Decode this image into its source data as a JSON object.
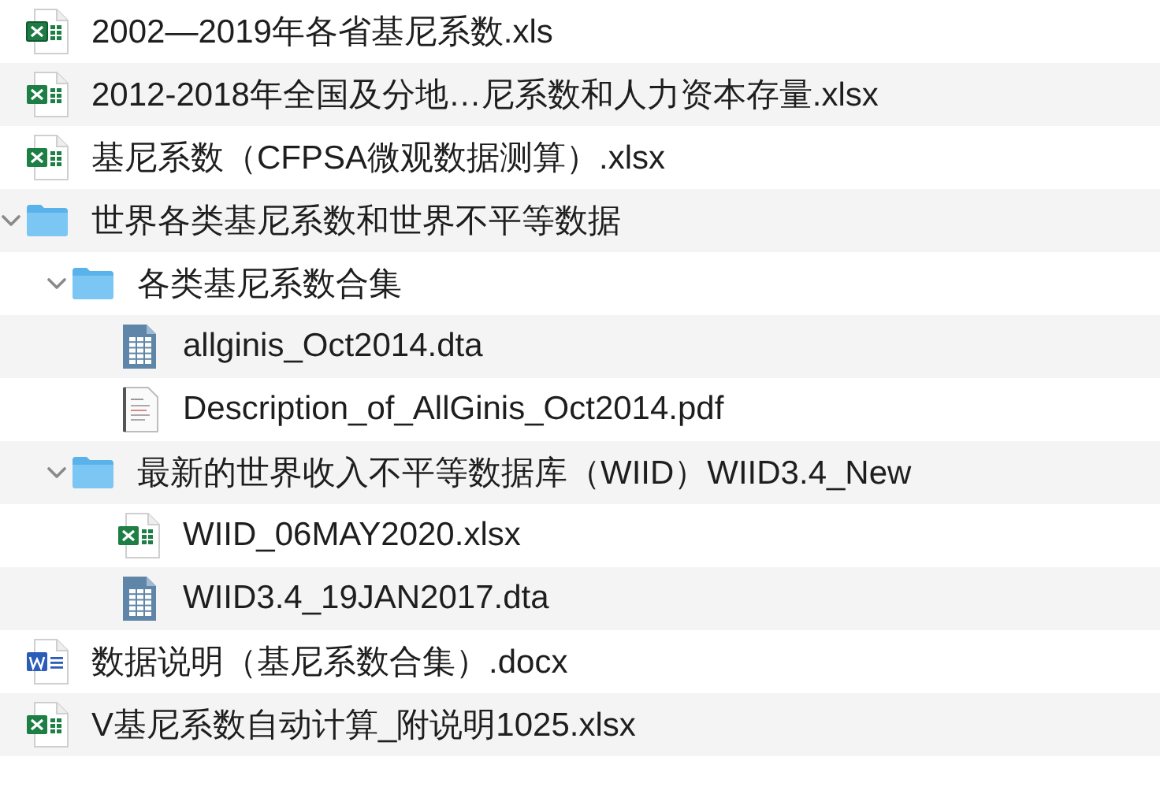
{
  "items": [
    {
      "kind": "xls",
      "name": "2002—2019年各省基尼系数.xls"
    },
    {
      "kind": "xlsx",
      "name": "2012-2018年全国及分地…尼系数和人力资本存量.xlsx"
    },
    {
      "kind": "xlsx",
      "name": "基尼系数（CFPSA微观数据测算）.xlsx"
    },
    {
      "kind": "folder",
      "name": "世界各类基尼系数和世界不平等数据",
      "expanded": true,
      "children": [
        {
          "kind": "folder",
          "name": "各类基尼系数合集",
          "expanded": true,
          "children": [
            {
              "kind": "dta",
              "name": "allginis_Oct2014.dta"
            },
            {
              "kind": "pdf",
              "name": "Description_of_AllGinis_Oct2014.pdf"
            }
          ]
        },
        {
          "kind": "folder",
          "name": "最新的世界收入不平等数据库（WIID）WIID3.4_New",
          "expanded": true,
          "children": [
            {
              "kind": "xlsx",
              "name": "WIID_06MAY2020.xlsx"
            },
            {
              "kind": "dta",
              "name": "WIID3.4_19JAN2017.dta"
            }
          ]
        }
      ]
    },
    {
      "kind": "docx",
      "name": "数据说明（基尼系数合集）.docx"
    },
    {
      "kind": "xlsx",
      "name": "V基尼系数自动计算_附说明1025.xlsx"
    }
  ]
}
